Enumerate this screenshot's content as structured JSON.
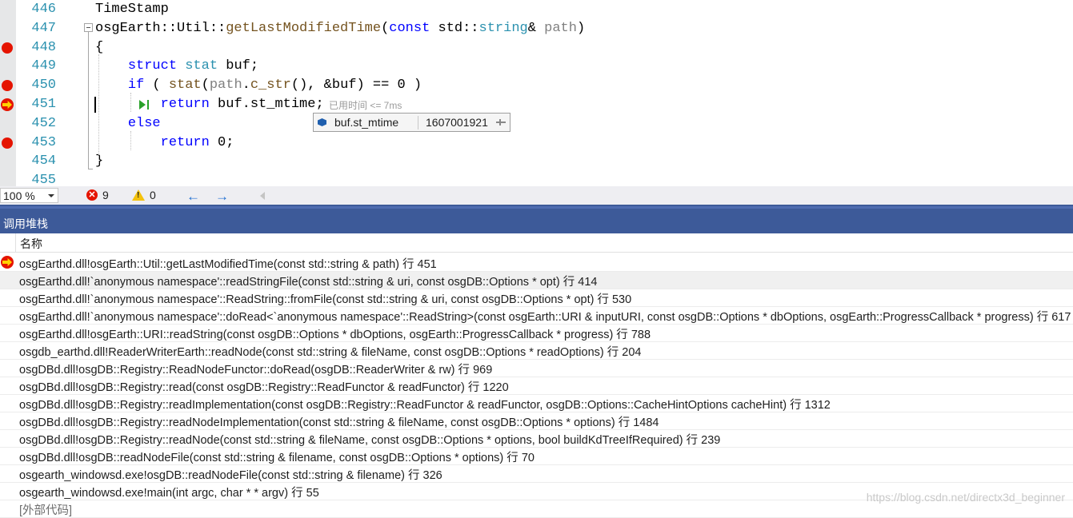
{
  "editor": {
    "lines": [
      {
        "num": "446",
        "tokens": [
          {
            "t": "TimeStamp",
            "c": "nm"
          }
        ]
      },
      {
        "num": "447",
        "tokens": [
          {
            "t": "osgEarth::Util::",
            "c": "nm"
          },
          {
            "t": "getLastModifiedTime",
            "c": "fn"
          },
          {
            "t": "(",
            "c": "nm"
          },
          {
            "t": "const",
            "c": "kw"
          },
          {
            "t": " std::",
            "c": "nm"
          },
          {
            "t": "string",
            "c": "ty"
          },
          {
            "t": "& ",
            "c": "nm"
          },
          {
            "t": "path",
            "c": "pm"
          },
          {
            "t": ")",
            "c": "nm"
          }
        ]
      },
      {
        "num": "448",
        "tokens": [
          {
            "t": "{",
            "c": "nm"
          }
        ]
      },
      {
        "num": "449",
        "tokens": [
          {
            "t": "    ",
            "c": "nm"
          },
          {
            "t": "struct",
            "c": "kw"
          },
          {
            "t": " ",
            "c": "nm"
          },
          {
            "t": "stat",
            "c": "ty"
          },
          {
            "t": " buf;",
            "c": "nm"
          }
        ]
      },
      {
        "num": "450",
        "tokens": [
          {
            "t": "    ",
            "c": "nm"
          },
          {
            "t": "if",
            "c": "kw"
          },
          {
            "t": " ( ",
            "c": "nm"
          },
          {
            "t": "stat",
            "c": "fn"
          },
          {
            "t": "(",
            "c": "nm"
          },
          {
            "t": "path",
            "c": "pm"
          },
          {
            "t": ".",
            "c": "nm"
          },
          {
            "t": "c_str",
            "c": "fn"
          },
          {
            "t": "(), &buf) == 0 )",
            "c": "nm"
          }
        ]
      },
      {
        "num": "451",
        "tokens": [
          {
            "t": "        ",
            "c": "nm"
          },
          {
            "t": "return",
            "c": "kw"
          },
          {
            "t": " buf.st_mtime;",
            "c": "nm"
          }
        ]
      },
      {
        "num": "452",
        "tokens": [
          {
            "t": "    ",
            "c": "nm"
          },
          {
            "t": "else",
            "c": "kw"
          }
        ]
      },
      {
        "num": "453",
        "tokens": [
          {
            "t": "        ",
            "c": "nm"
          },
          {
            "t": "return",
            "c": "kw"
          },
          {
            "t": " 0;",
            "c": "nm"
          }
        ]
      },
      {
        "num": "454",
        "tokens": [
          {
            "t": "}",
            "c": "nm"
          }
        ]
      },
      {
        "num": "455",
        "tokens": []
      }
    ],
    "breakpoints": [
      "448",
      "450",
      "453"
    ],
    "current_line": "451",
    "perf_tip": "已用时间 <= 7ms",
    "datatip": {
      "name": "buf.st_mtime",
      "value": "1607001921"
    }
  },
  "status_bar": {
    "zoom": "100 %",
    "errors": "9",
    "warnings": "0",
    "nav_back": "←",
    "nav_forward": "→"
  },
  "call_stack": {
    "title": "调用堆栈",
    "column_name": "名称",
    "rows": [
      {
        "text": "osgEarthd.dll!osgEarth::Util::getLastModifiedTime(const std::string & path) 行 451",
        "current": true
      },
      {
        "text": "osgEarthd.dll!`anonymous namespace'::readStringFile(const std::string & uri, const osgDB::Options * opt) 行 414"
      },
      {
        "text": "osgEarthd.dll!`anonymous namespace'::ReadString::fromFile(const std::string & uri, const osgDB::Options * opt) 行 530"
      },
      {
        "text": "osgEarthd.dll!`anonymous namespace'::doRead<`anonymous namespace'::ReadString>(const osgEarth::URI & inputURI, const osgDB::Options * dbOptions, osgEarth::ProgressCallback * progress) 行 617"
      },
      {
        "text": "osgEarthd.dll!osgEarth::URI::readString(const osgDB::Options * dbOptions, osgEarth::ProgressCallback * progress) 行 788"
      },
      {
        "text": "osgdb_earthd.dll!ReaderWriterEarth::readNode(const std::string & fileName, const osgDB::Options * readOptions) 行 204"
      },
      {
        "text": "osgDBd.dll!osgDB::Registry::ReadNodeFunctor::doRead(osgDB::ReaderWriter & rw) 行 969"
      },
      {
        "text": "osgDBd.dll!osgDB::Registry::read(const osgDB::Registry::ReadFunctor & readFunctor) 行 1220"
      },
      {
        "text": "osgDBd.dll!osgDB::Registry::readImplementation(const osgDB::Registry::ReadFunctor & readFunctor, osgDB::Options::CacheHintOptions cacheHint) 行 1312"
      },
      {
        "text": "osgDBd.dll!osgDB::Registry::readNodeImplementation(const std::string & fileName, const osgDB::Options * options) 行 1484"
      },
      {
        "text": "osgDBd.dll!osgDB::Registry::readNode(const std::string & fileName, const osgDB::Options * options, bool buildKdTreeIfRequired) 行 239"
      },
      {
        "text": "osgDBd.dll!osgDB::readNodeFile(const std::string & filename, const osgDB::Options * options) 行 70"
      },
      {
        "text": "osgearth_windowsd.exe!osgDB::readNodeFile(const std::string & filename) 行 326"
      },
      {
        "text": "osgearth_windowsd.exe!main(int argc, char * * argv) 行 55"
      },
      {
        "text": "[外部代码]",
        "external": true
      }
    ]
  },
  "watermark": "https://blog.csdn.net/directx3d_beginner",
  "colors": {
    "accent": "#3d5a99",
    "breakpoint": "#e51400",
    "keyword": "#0000ff",
    "type": "#2b91af"
  }
}
